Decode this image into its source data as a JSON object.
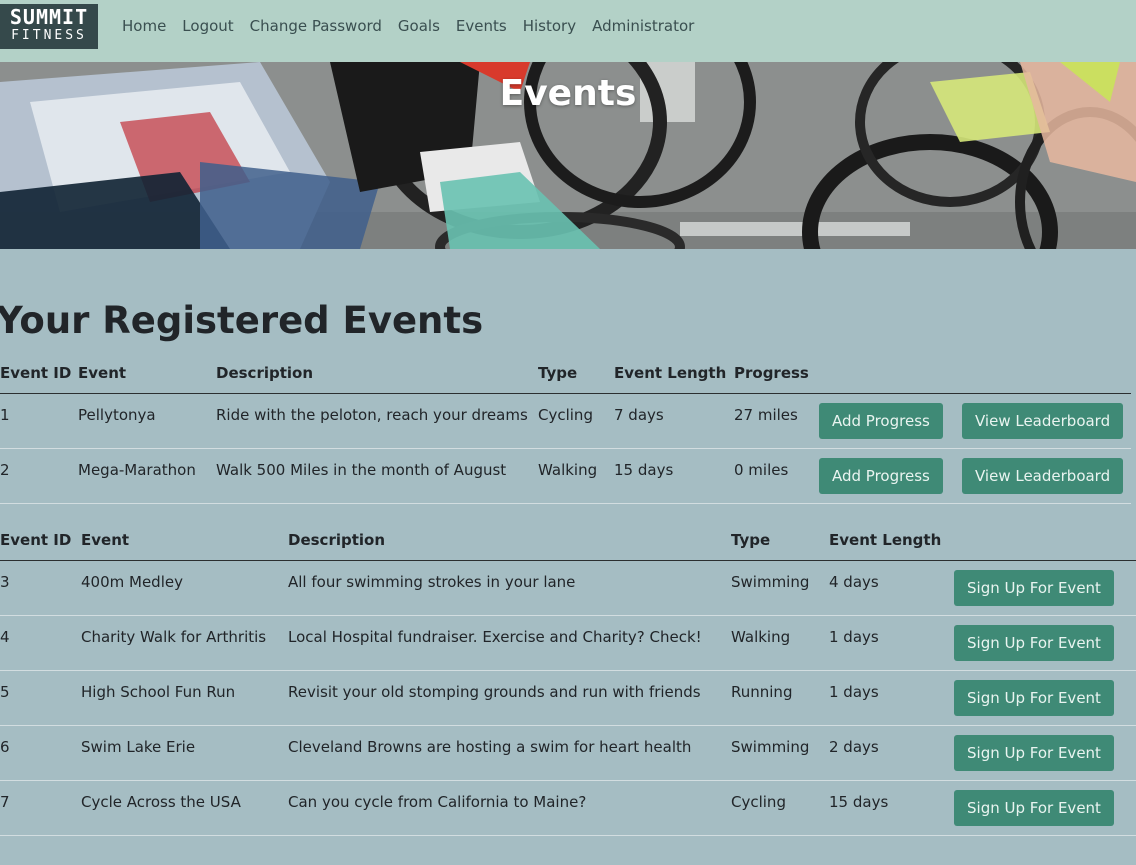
{
  "nav": {
    "logo_top": "SUMMIT",
    "logo_bottom": "FITNESS",
    "links": [
      "Home",
      "Logout",
      "Change Password",
      "Goals",
      "Events",
      "History",
      "Administrator"
    ]
  },
  "hero": {
    "title": "Events"
  },
  "registered": {
    "heading": "Your Registered Events",
    "columns": [
      "Event ID",
      "Event",
      "Description",
      "Type",
      "Event Length",
      "Progress"
    ],
    "rows": [
      {
        "id": "1",
        "event": "Pellytonya",
        "description": "Ride with the peloton, reach your dreams",
        "type": "Cycling",
        "length": "7 days",
        "progress": "27 miles",
        "add_label": "Add Progress",
        "leader_label": "View Leaderboard"
      },
      {
        "id": "2",
        "event": "Mega-Marathon",
        "description": "Walk 500 Miles in the month of August",
        "type": "Walking",
        "length": "15 days",
        "progress": "0 miles",
        "add_label": "Add Progress",
        "leader_label": "View Leaderboard"
      }
    ]
  },
  "available": {
    "columns": [
      "Event ID",
      "Event",
      "Description",
      "Type",
      "Event Length"
    ],
    "rows": [
      {
        "id": "3",
        "event": "400m Medley",
        "description": "All four swimming strokes in your lane",
        "type": "Swimming",
        "length": "4 days",
        "signup_label": "Sign Up For Event"
      },
      {
        "id": "4",
        "event": "Charity Walk for Arthritis",
        "description": "Local Hospital fundraiser. Exercise and Charity? Check!",
        "type": "Walking",
        "length": "1 days",
        "signup_label": "Sign Up For Event"
      },
      {
        "id": "5",
        "event": "High School Fun Run",
        "description": "Revisit your old stomping grounds and run with friends",
        "type": "Running",
        "length": "1 days",
        "signup_label": "Sign Up For Event"
      },
      {
        "id": "6",
        "event": "Swim Lake Erie",
        "description": "Cleveland Browns are hosting a swim for heart health",
        "type": "Swimming",
        "length": "2 days",
        "signup_label": "Sign Up For Event"
      },
      {
        "id": "7",
        "event": "Cycle Across the USA",
        "description": "Can you cycle from California to Maine?",
        "type": "Cycling",
        "length": "15 days",
        "signup_label": "Sign Up For Event"
      }
    ]
  },
  "colors": {
    "navbar": "#b3d1c7",
    "page": "#a5bdc3",
    "button": "#3f8a76",
    "logo_bg": "#35494b"
  }
}
